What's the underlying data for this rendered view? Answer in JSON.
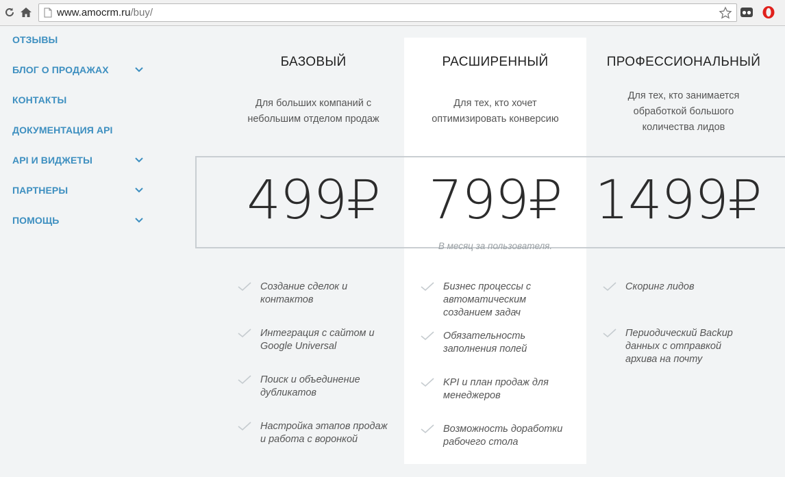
{
  "browser": {
    "url_host": "www.amocrm.ru",
    "url_path": "/buy/"
  },
  "sidebar": {
    "items": [
      {
        "label": "ОТЗЫВЫ",
        "has_submenu": false
      },
      {
        "label": "БЛОГ О ПРОДАЖАХ",
        "has_submenu": true
      },
      {
        "label": "КОНТАКТЫ",
        "has_submenu": false
      },
      {
        "label": "ДОКУМЕНТАЦИЯ API",
        "has_submenu": false
      },
      {
        "label": "API И ВИДЖЕТЫ",
        "has_submenu": true
      },
      {
        "label": "ПАРТНЕРЫ",
        "has_submenu": true
      },
      {
        "label": "ПОМОЩЬ",
        "has_submenu": true
      }
    ]
  },
  "plans": [
    {
      "title": "БАЗОВЫЙ",
      "desc_lines": [
        "Для больших компаний с",
        "небольшим отделом продаж"
      ],
      "price": "499₽",
      "features": [
        [
          "Создание сделок и",
          "контактов"
        ],
        [
          "Интеграция с сайтом и",
          "Google Universal"
        ],
        [
          "Поиск и объединение",
          "дубликатов"
        ],
        [
          "Настройка этапов продаж",
          "и работа с воронкой"
        ]
      ]
    },
    {
      "title": "РАСШИРЕННЫЙ",
      "desc_lines": [
        "Для тех, кто хочет",
        "оптимизировать конверсию"
      ],
      "price": "799₽",
      "features": [
        [
          "Бизнес процессы с",
          "автоматическим",
          "созданием задач"
        ],
        [
          "Обязательность",
          "заполнения полей"
        ],
        [
          "KPI и план продаж для",
          "менеджеров"
        ],
        [
          "Возможность доработки",
          "рабочего стола"
        ]
      ]
    },
    {
      "title": "ПРОФЕССИОНАЛЬНЫЙ",
      "desc_lines": [
        "Для тех, кто занимается",
        "обработкой большого",
        "количества лидов"
      ],
      "price": "1499₽",
      "features": [
        [
          "Скоринг лидов"
        ],
        [
          "Периодический Backup",
          "данных с отправкой",
          "архива на почту"
        ]
      ]
    }
  ],
  "per_month_note": "В месяц за пользователя.",
  "colors": {
    "accent": "#3d8fc0",
    "background": "#f2f4f5",
    "check": "#c5cbcf"
  },
  "icons": [
    "reload-icon",
    "home-icon",
    "page-icon",
    "star-icon",
    "extension-icon",
    "opera-icon",
    "chevron-down-icon",
    "check-icon"
  ]
}
